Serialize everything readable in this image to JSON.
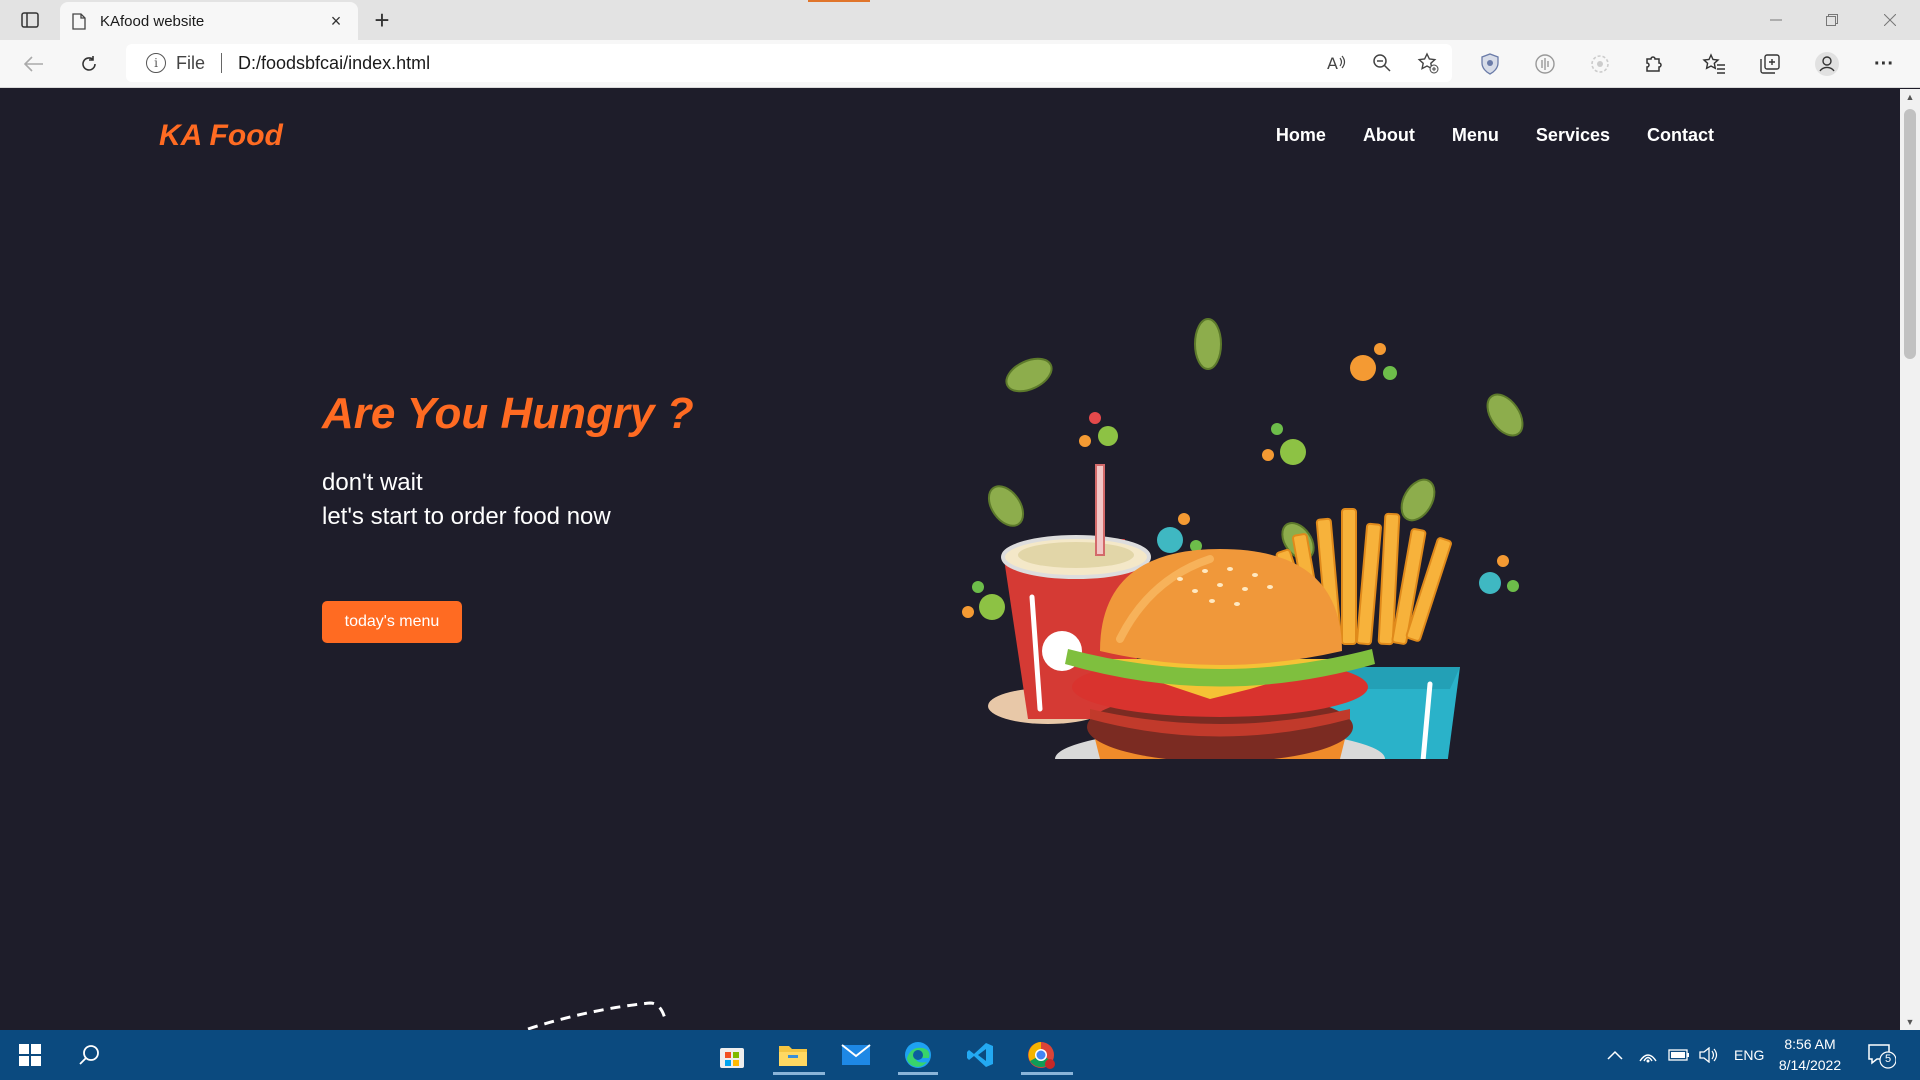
{
  "browser": {
    "tab_title": "KAfood website",
    "address_scheme": "File",
    "address_url": "D:/foodsbfcai/index.html",
    "tab_close_glyph": "×",
    "new_tab_glyph": "+",
    "more_glyph": "···"
  },
  "site": {
    "logo": "KA Food",
    "nav": [
      "Home",
      "About",
      "Menu",
      "Services",
      "Contact"
    ],
    "hero_title": "Are You Hungry ?",
    "hero_line1": "don't wait",
    "hero_line2": "let's start to order food now",
    "hero_button": "today's menu"
  },
  "taskbar": {
    "language": "ENG",
    "time": "8:56 AM",
    "date": "8/14/2022",
    "notification_count": "5"
  },
  "colors": {
    "page_bg": "#1e1d2a",
    "accent": "#ff6b22",
    "taskbar": "#0b4a7f"
  }
}
